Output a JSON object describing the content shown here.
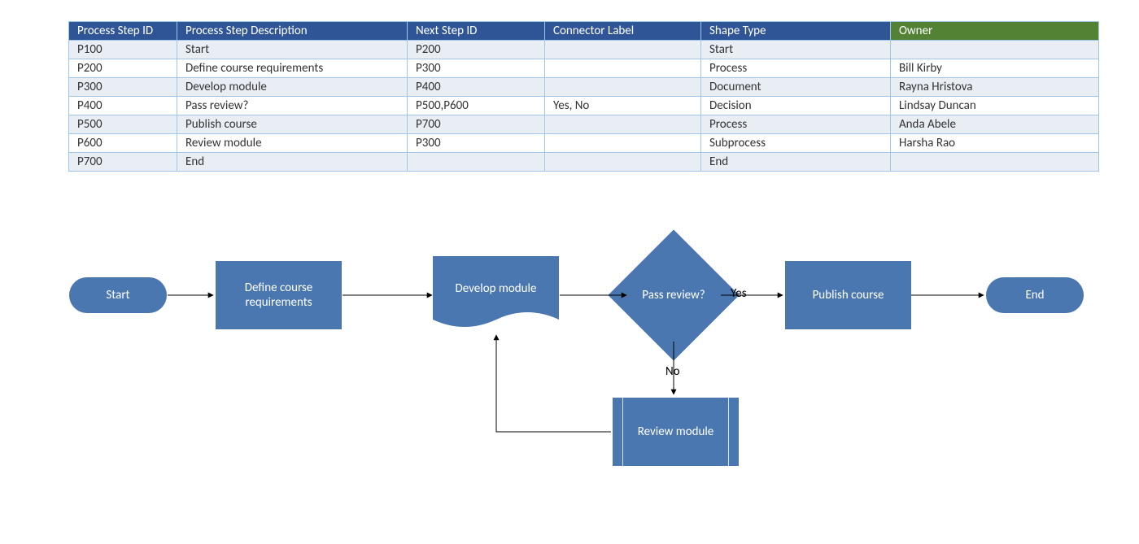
{
  "headers": {
    "c0": "Process Step ID",
    "c1": "Process Step Description",
    "c2": "Next Step ID",
    "c3": "Connector Label",
    "c4": "Shape Type",
    "c5": "Owner"
  },
  "rows": [
    {
      "c0": "P100",
      "c1": "Start",
      "c2": "P200",
      "c3": "",
      "c4": "Start",
      "c5": ""
    },
    {
      "c0": "P200",
      "c1": "Define course requirements",
      "c2": "P300",
      "c3": "",
      "c4": "Process",
      "c5": "Bill Kirby"
    },
    {
      "c0": "P300",
      "c1": "Develop module",
      "c2": "P400",
      "c3": "",
      "c4": "Document",
      "c5": "Rayna Hristova"
    },
    {
      "c0": "P400",
      "c1": "Pass review?",
      "c2": "P500,P600",
      "c3": "Yes, No",
      "c4": "Decision",
      "c5": "Lindsay Duncan"
    },
    {
      "c0": "P500",
      "c1": "Publish course",
      "c2": "P700",
      "c3": "",
      "c4": "Process",
      "c5": "Anda Abele"
    },
    {
      "c0": "P600",
      "c1": "Review module",
      "c2": "P300",
      "c3": "",
      "c4": "Subprocess",
      "c5": "Harsha Rao"
    },
    {
      "c0": "P700",
      "c1": "End",
      "c2": "",
      "c3": "",
      "c4": "End",
      "c5": ""
    }
  ],
  "nodes": {
    "start": "Start",
    "define": "Define course requirements",
    "develop": "Develop module",
    "decision": "Pass review?",
    "publish": "Publish course",
    "end": "End",
    "review": "Review module"
  },
  "labels": {
    "yes": "Yes",
    "no": "No"
  }
}
